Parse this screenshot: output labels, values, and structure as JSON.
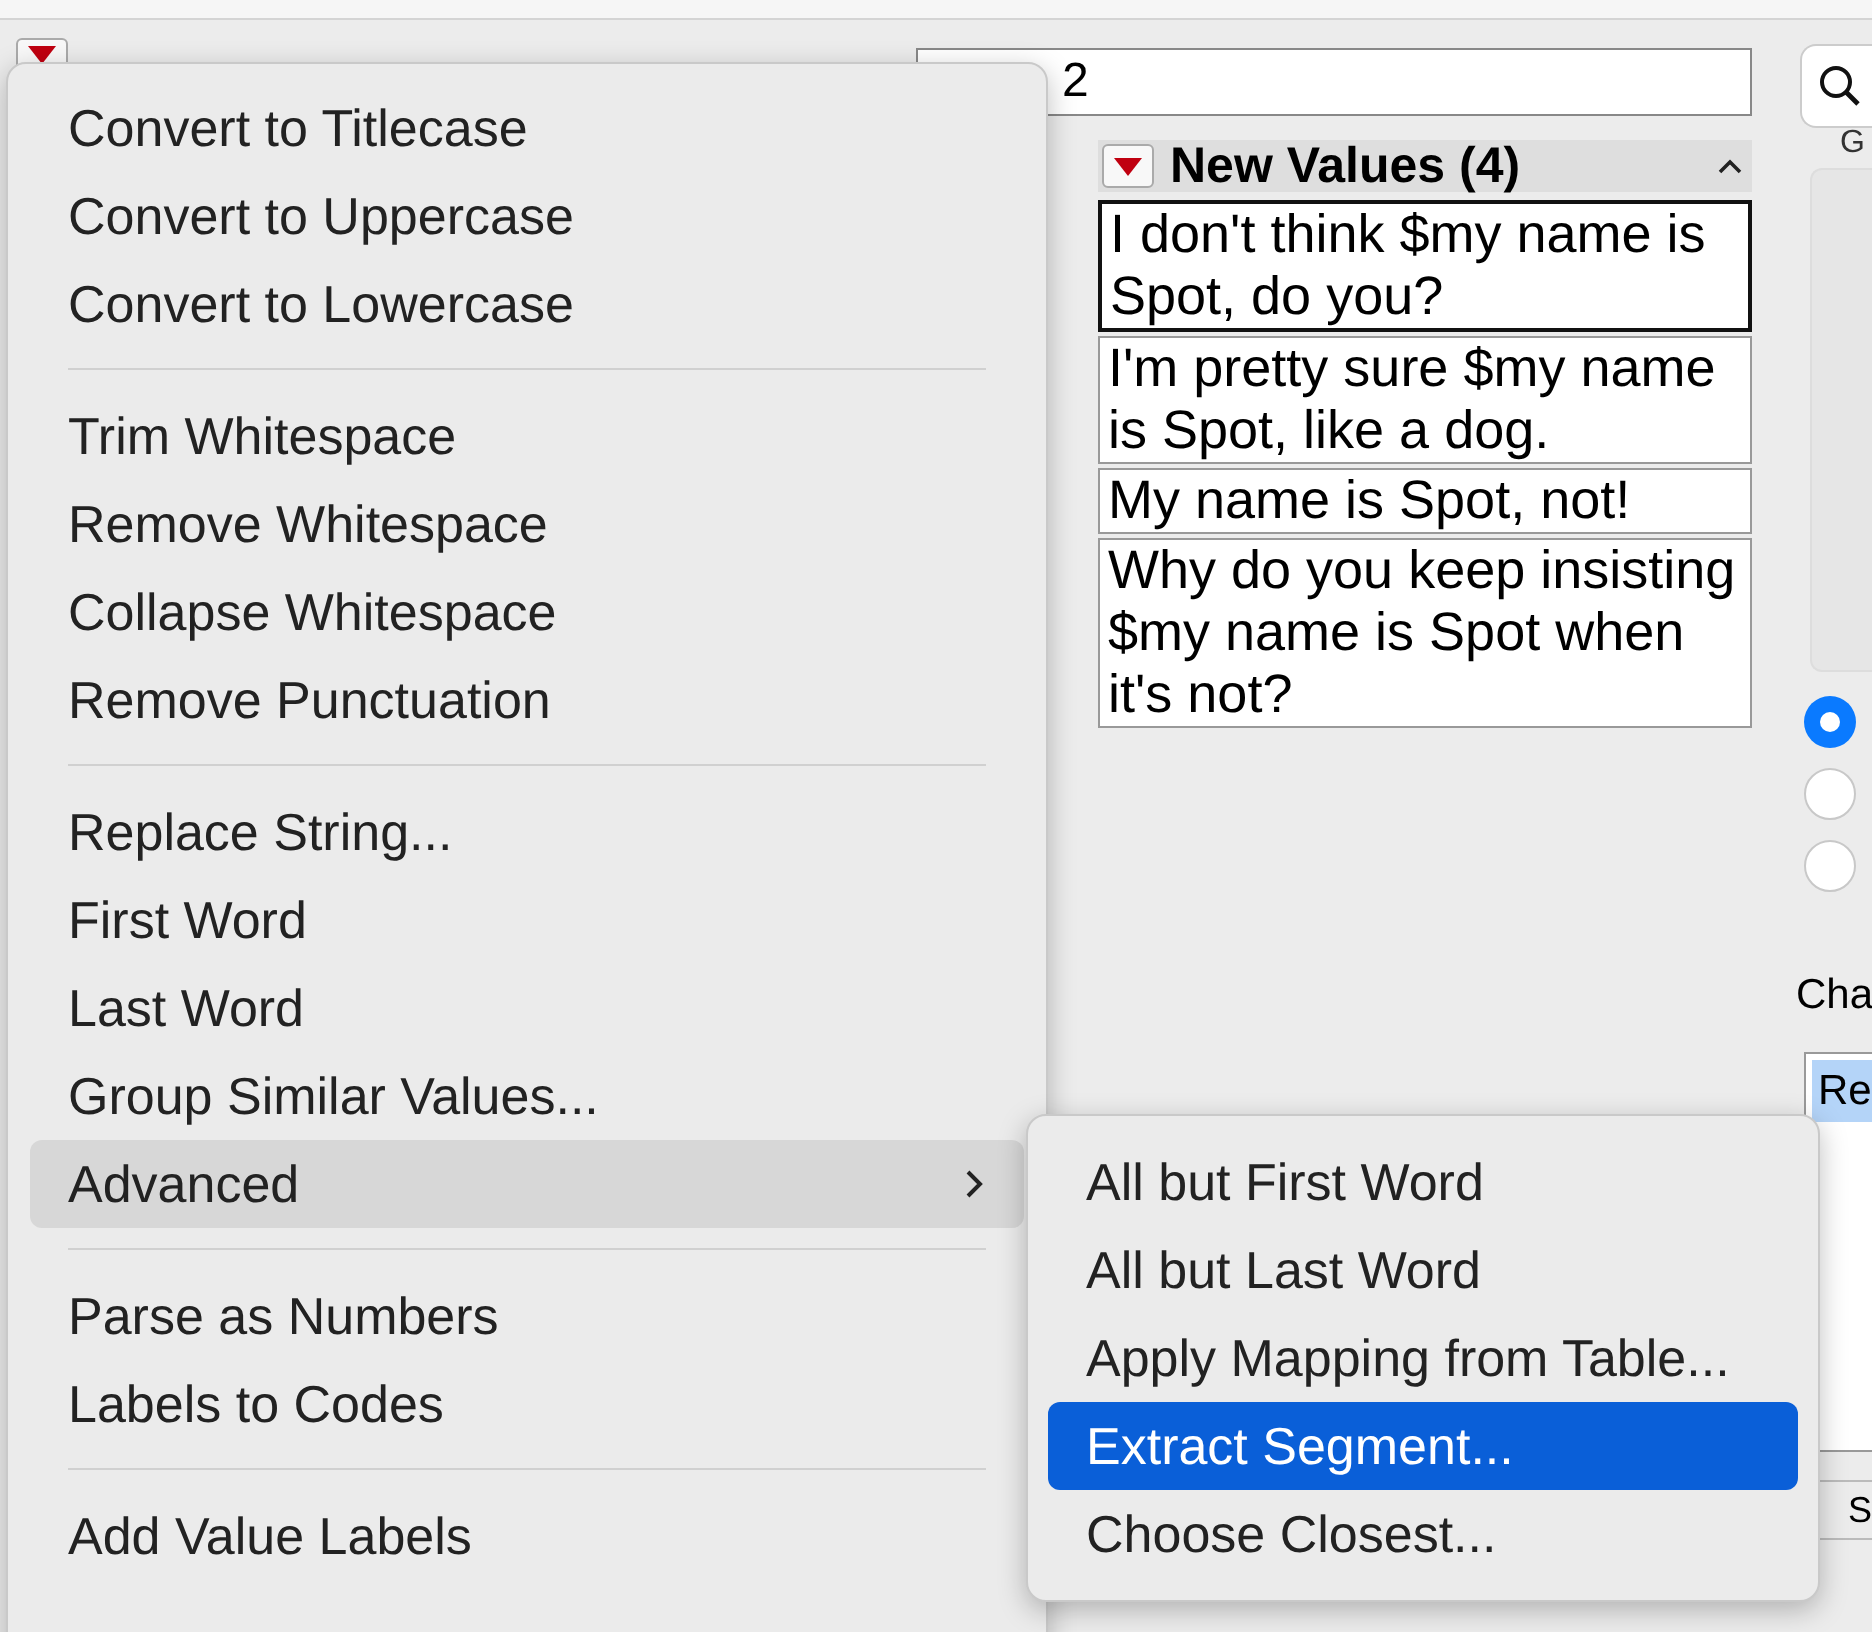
{
  "field": {
    "value": "2"
  },
  "new_values": {
    "title": "New Values (4)",
    "values": [
      {
        "text": "I don't think $my name is Spot, do you?",
        "selected": true
      },
      {
        "text": "I'm pretty sure $my name is Spot, like a dog.",
        "selected": false
      },
      {
        "text": "My name is Spot, not!",
        "selected": false
      },
      {
        "text": "Why do you keep insisting $my name is Spot when it's not?",
        "selected": false
      }
    ]
  },
  "right_panel": {
    "top_label": "G",
    "radios": [
      {
        "selected": true
      },
      {
        "selected": false
      },
      {
        "selected": false
      }
    ],
    "label": "Cha",
    "list_items": [
      {
        "text": "Re",
        "selected": true
      }
    ],
    "bottom_tab": "S"
  },
  "menu": {
    "groups": [
      [
        {
          "label": "Convert to Titlecase",
          "disabled": false,
          "highlighted": false,
          "submenu": false
        },
        {
          "label": "Convert to Uppercase",
          "disabled": false,
          "highlighted": false,
          "submenu": false
        },
        {
          "label": "Convert to Lowercase",
          "disabled": false,
          "highlighted": false,
          "submenu": false
        }
      ],
      [
        {
          "label": "Trim Whitespace",
          "disabled": false,
          "highlighted": false,
          "submenu": false
        },
        {
          "label": "Remove Whitespace",
          "disabled": false,
          "highlighted": false,
          "submenu": false
        },
        {
          "label": "Collapse Whitespace",
          "disabled": false,
          "highlighted": false,
          "submenu": false
        },
        {
          "label": "Remove Punctuation",
          "disabled": false,
          "highlighted": false,
          "submenu": false
        }
      ],
      [
        {
          "label": "Replace String...",
          "disabled": false,
          "highlighted": false,
          "submenu": false
        },
        {
          "label": "First Word",
          "disabled": false,
          "highlighted": false,
          "submenu": false
        },
        {
          "label": "Last Word",
          "disabled": false,
          "highlighted": false,
          "submenu": false
        },
        {
          "label": "Group Similar Values...",
          "disabled": false,
          "highlighted": false,
          "submenu": false
        },
        {
          "label": "Advanced",
          "disabled": false,
          "highlighted": true,
          "submenu": true
        }
      ],
      [
        {
          "label": "Parse as Numbers",
          "disabled": false,
          "highlighted": false,
          "submenu": false
        },
        {
          "label": "Labels to Codes",
          "disabled": false,
          "highlighted": false,
          "submenu": false
        }
      ],
      [
        {
          "label": "Add Value Labels",
          "disabled": false,
          "highlighted": false,
          "submenu": false
        }
      ]
    ]
  },
  "submenu": {
    "items": [
      {
        "label": "All but First Word",
        "selected": false
      },
      {
        "label": "All but Last Word",
        "selected": false
      },
      {
        "label": "Apply Mapping from Table...",
        "selected": false
      },
      {
        "label": "Extract Segment...",
        "selected": true
      },
      {
        "label": "Choose Closest...",
        "selected": false
      }
    ]
  }
}
